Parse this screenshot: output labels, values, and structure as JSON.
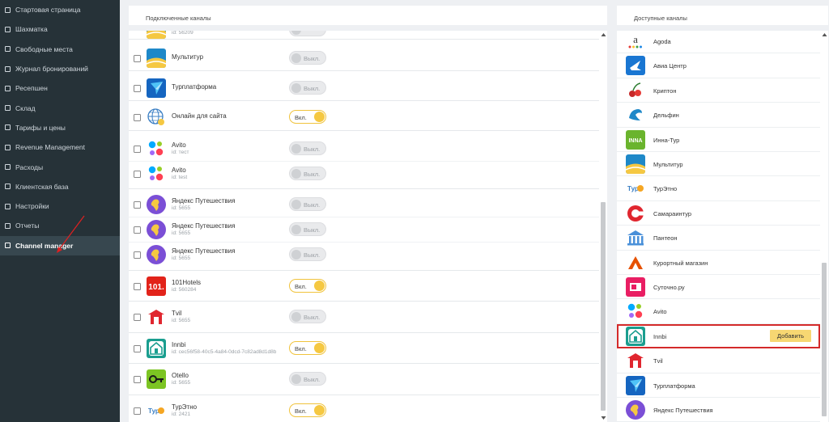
{
  "sidebar": {
    "items": [
      {
        "label": "Стартовая страница",
        "icon": "bookmark-icon"
      },
      {
        "label": "Шахматка",
        "icon": "grid-icon"
      },
      {
        "label": "Свободные места",
        "icon": "grid-icon"
      },
      {
        "label": "Журнал бронирований",
        "icon": "journal-icon"
      },
      {
        "label": "Ресепшен",
        "icon": "list-icon"
      },
      {
        "label": "Склад",
        "icon": "box-icon"
      },
      {
        "label": "Тарифы и цены",
        "icon": "list-icon"
      },
      {
        "label": "Revenue Management",
        "icon": "chart-icon"
      },
      {
        "label": "Расходы",
        "icon": "list-icon"
      },
      {
        "label": "Клиентская база",
        "icon": "grid-icon"
      },
      {
        "label": "Настройки",
        "icon": "gear-icon"
      },
      {
        "label": "Отчеты",
        "icon": "document-icon"
      },
      {
        "label": "Channel manager",
        "icon": "list-icon",
        "active": true
      }
    ]
  },
  "connected": {
    "title": "Подключенные каналы",
    "partial_id": "id: 56209",
    "rows": [
      {
        "name": "Мультитур",
        "id": "",
        "toggle": "Выкл.",
        "on": false,
        "logo": "multitour-logo"
      },
      {
        "name": "Турплатформа",
        "id": "",
        "toggle": "Выкл.",
        "on": false,
        "logo": "turplatforma-logo"
      },
      {
        "name": "Онлайн для сайта",
        "id": "",
        "toggle": "Вкл.",
        "on": true,
        "logo": "globe-logo"
      },
      {
        "name": "Avito",
        "id": "id: тест",
        "toggle": "Выкл.",
        "on": false,
        "logo": "avito-logo"
      },
      {
        "name": "Avito",
        "id": "id: test",
        "toggle": "Выкл.",
        "on": false,
        "logo": "avito-logo"
      },
      {
        "name": "Яндекс Путешествия",
        "id": "id: 5655",
        "toggle": "Выкл.",
        "on": false,
        "logo": "yandex-travel-logo"
      },
      {
        "name": "Яндекс Путешествия",
        "id": "id: 5655",
        "toggle": "Выкл.",
        "on": false,
        "logo": "yandex-travel-logo"
      },
      {
        "name": "Яндекс Путешествия",
        "id": "id: 5655",
        "toggle": "Выкл.",
        "on": false,
        "logo": "yandex-travel-logo"
      },
      {
        "name": "101Hotels",
        "id": "id: 560284",
        "toggle": "Вкл.",
        "on": true,
        "logo": "101hotels-logo"
      },
      {
        "name": "Tvil",
        "id": "id: 5655",
        "toggle": "Выкл.",
        "on": false,
        "logo": "tvil-logo"
      },
      {
        "name": "Innbi",
        "id": "id: cec56f58-40c5-4a84-0dcd-7c82ad8d1d8b",
        "toggle": "Вкл.",
        "on": true,
        "logo": "innbi-logo"
      },
      {
        "name": "Otello",
        "id": "id: 5655",
        "toggle": "Выкл.",
        "on": false,
        "logo": "otello-logo"
      },
      {
        "name": "ТурЭтно",
        "id": "id: 2421",
        "toggle": "Вкл.",
        "on": true,
        "logo": "turetno-logo"
      }
    ]
  },
  "available": {
    "title": "Доступные каналы",
    "add_label": "Добавить",
    "rows": [
      {
        "name": "Agoda",
        "logo": "agoda-logo"
      },
      {
        "name": "Авиа Центр",
        "logo": "avia-center-logo"
      },
      {
        "name": "Криптон",
        "logo": "kripton-logo"
      },
      {
        "name": "Дельфин",
        "logo": "delfin-logo"
      },
      {
        "name": "Инна-Тур",
        "logo": "inna-tour-logo"
      },
      {
        "name": "Мультитур",
        "logo": "multitour-logo"
      },
      {
        "name": "ТурЭтно",
        "logo": "turetno-logo"
      },
      {
        "name": "Самараинтур",
        "logo": "samaraintur-logo"
      },
      {
        "name": "Пантеон",
        "logo": "panteon-logo"
      },
      {
        "name": "Курортный магазин",
        "logo": "kurort-logo"
      },
      {
        "name": "Суточно.ру",
        "logo": "sutochno-logo"
      },
      {
        "name": "Avito",
        "logo": "avito-logo"
      },
      {
        "name": "Innbi",
        "logo": "innbi-logo",
        "highlight": true
      },
      {
        "name": "Tvil",
        "logo": "tvil-logo"
      },
      {
        "name": "Турплатформа",
        "logo": "turplatforma-logo"
      },
      {
        "name": "Яндекс Путешествия",
        "logo": "yandex-travel-logo"
      }
    ]
  }
}
